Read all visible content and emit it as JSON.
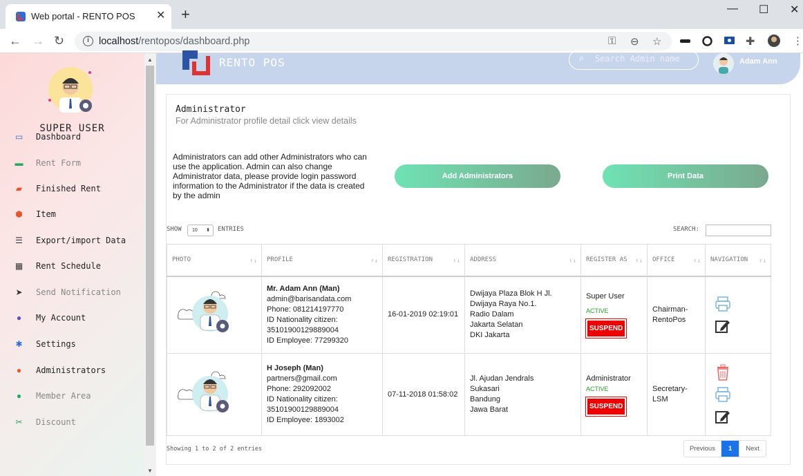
{
  "browser": {
    "tab_title": "Web portal - RENTO POS",
    "tab_close": "✕",
    "new_tab": "+",
    "url_host": "localhost",
    "url_path": "/rentopos/dashboard.php",
    "minimize": "—",
    "maximize": "☐",
    "close": "✕"
  },
  "sidebar": {
    "title": "SUPER USER",
    "items": [
      {
        "label": "Dashboard",
        "icon": "monitor-icon",
        "glyph": "▭",
        "color": "#2b6fd6",
        "dim": false
      },
      {
        "label": "Rent Form",
        "icon": "rent-form-icon",
        "glyph": "▬",
        "color": "#2aa760",
        "dim": true
      },
      {
        "label": "Finished Rent",
        "icon": "folder-icon",
        "glyph": "▰",
        "color": "#e8552a",
        "dim": false
      },
      {
        "label": "Item",
        "icon": "cube-icon",
        "glyph": "⬢",
        "color": "#e8552a",
        "dim": false
      },
      {
        "label": "Export/import Data",
        "icon": "list-icon",
        "glyph": "☰",
        "color": "#333",
        "dim": false
      },
      {
        "label": "Rent Schedule",
        "icon": "calendar-icon",
        "glyph": "▦",
        "color": "#333",
        "dim": false
      },
      {
        "label": "Send Notification",
        "icon": "send-icon",
        "glyph": "➤",
        "color": "#333",
        "dim": true
      },
      {
        "label": "My Account",
        "icon": "account-icon",
        "glyph": "●",
        "color": "#5a4fcf",
        "dim": false
      },
      {
        "label": "Settings",
        "icon": "gear-icon",
        "glyph": "✱",
        "color": "#2b6fd6",
        "dim": false
      },
      {
        "label": "Administrators",
        "icon": "admin-user-icon",
        "glyph": "●",
        "color": "#e8552a",
        "dim": false
      },
      {
        "label": "Member Area",
        "icon": "member-icon",
        "glyph": "●",
        "color": "#2aa760",
        "dim": true
      },
      {
        "label": "Discount",
        "icon": "scissors-icon",
        "glyph": "✂",
        "color": "#2aa760",
        "dim": true
      }
    ]
  },
  "topbar": {
    "brand": "RENTO POS",
    "search_placeholder": "Search Admin name",
    "user_name": "Adam Ann"
  },
  "content": {
    "title": "Administrator",
    "subtitle": "For Administrator profile detail click view details",
    "description": "Administrators can add other Administrators who can use the application. Admin can also change Administrator data, please provide login password information to the Administrator if the data is created by the admin",
    "add_button": "Add Administrators",
    "print_button": "Print Data",
    "show_label": "SHOW",
    "show_value": "10",
    "entries_label": "ENTRIES",
    "search_label": "SEARCH:",
    "footer_info": "Showing 1 to 2 of 2 entries",
    "pager": {
      "prev": "Previous",
      "page": "1",
      "next": "Next"
    }
  },
  "table": {
    "columns": [
      "PHOTO",
      "PROFILE",
      "REGISTRATION",
      "ADDRESS",
      "REGISTER AS",
      "OFFICE",
      "NAVIGATION"
    ],
    "rows": [
      {
        "name": "Mr. Adam Ann (Man)",
        "email": "admin@barisandata.com",
        "phone": "Phone: 081214197770",
        "id_label": "ID Nationality citizen:",
        "id_value": "35101900129889004",
        "employee": "ID Employee: 77299320",
        "registration": "16-01-2019 02:19:01",
        "address": [
          "Dwijaya Plaza Blok H Jl.",
          "Dwijaya Raya No.1.",
          "Radio Dalam",
          "Jakarta Selatan",
          "DKI Jakarta"
        ],
        "register_as": "Super User",
        "status": "ACTIVE",
        "suspend": "SUSPEND",
        "office": "Chairman-RentoPos"
      },
      {
        "name": "H Joseph (Man)",
        "email": "partners@gmail.com",
        "phone": "Phone: 292092002",
        "id_label": "ID Nationality citizen:",
        "id_value": "35101900129889004",
        "employee": "ID Employee: 1893002",
        "registration": "07-11-2018 01:58:02",
        "address": [
          "Jl. Ajudan Jendrals",
          "Sukasari",
          "Bandung",
          "Jawa Barat"
        ],
        "register_as": "Administrator",
        "status": "ACTIVE",
        "suspend": "SUSPEND",
        "office": "Secretary-LSM"
      }
    ]
  }
}
